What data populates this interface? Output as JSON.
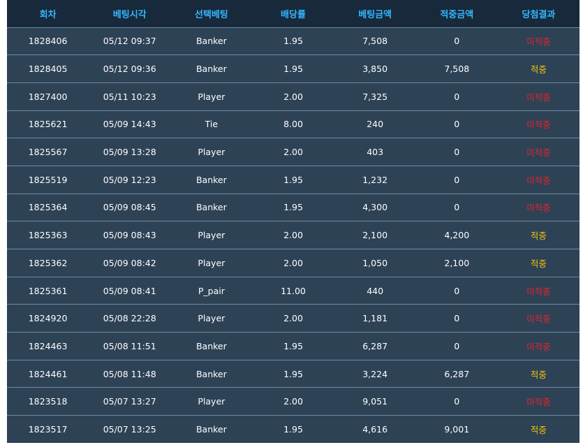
{
  "headers": [
    "회차",
    "베팅시각",
    "선택베팅",
    "배당률",
    "베팅금액",
    "적중금액",
    "당첨결과"
  ],
  "rows": [
    {
      "round": "1828406",
      "time": "05/12 09:37",
      "pick": "Banker",
      "odds": "1.95",
      "bet": "7,508",
      "payout": "0",
      "result": "미적중",
      "status": "lose"
    },
    {
      "round": "1828405",
      "time": "05/12 09:36",
      "pick": "Banker",
      "odds": "1.95",
      "bet": "3,850",
      "payout": "7,508",
      "result": "적중",
      "status": "win"
    },
    {
      "round": "1827400",
      "time": "05/11 10:23",
      "pick": "Player",
      "odds": "2.00",
      "bet": "7,325",
      "payout": "0",
      "result": "미적중",
      "status": "lose"
    },
    {
      "round": "1825621",
      "time": "05/09 14:43",
      "pick": "Tie",
      "odds": "8.00",
      "bet": "240",
      "payout": "0",
      "result": "미적중",
      "status": "lose"
    },
    {
      "round": "1825567",
      "time": "05/09 13:28",
      "pick": "Player",
      "odds": "2.00",
      "bet": "403",
      "payout": "0",
      "result": "미적중",
      "status": "lose"
    },
    {
      "round": "1825519",
      "time": "05/09 12:23",
      "pick": "Banker",
      "odds": "1.95",
      "bet": "1,232",
      "payout": "0",
      "result": "미적중",
      "status": "lose"
    },
    {
      "round": "1825364",
      "time": "05/09 08:45",
      "pick": "Banker",
      "odds": "1.95",
      "bet": "4,300",
      "payout": "0",
      "result": "미적중",
      "status": "lose"
    },
    {
      "round": "1825363",
      "time": "05/09 08:43",
      "pick": "Player",
      "odds": "2.00",
      "bet": "2,100",
      "payout": "4,200",
      "result": "적중",
      "status": "win"
    },
    {
      "round": "1825362",
      "time": "05/09 08:42",
      "pick": "Player",
      "odds": "2.00",
      "bet": "1,050",
      "payout": "2,100",
      "result": "적중",
      "status": "win"
    },
    {
      "round": "1825361",
      "time": "05/09 08:41",
      "pick": "P_pair",
      "odds": "11.00",
      "bet": "440",
      "payout": "0",
      "result": "미적중",
      "status": "lose"
    },
    {
      "round": "1824920",
      "time": "05/08 22:28",
      "pick": "Player",
      "odds": "2.00",
      "bet": "1,181",
      "payout": "0",
      "result": "미적중",
      "status": "lose"
    },
    {
      "round": "1824463",
      "time": "05/08 11:51",
      "pick": "Banker",
      "odds": "1.95",
      "bet": "6,287",
      "payout": "0",
      "result": "미적중",
      "status": "lose"
    },
    {
      "round": "1824461",
      "time": "05/08 11:48",
      "pick": "Banker",
      "odds": "1.95",
      "bet": "3,224",
      "payout": "6,287",
      "result": "적중",
      "status": "win"
    },
    {
      "round": "1823518",
      "time": "05/07 13:27",
      "pick": "Player",
      "odds": "2.00",
      "bet": "9,051",
      "payout": "0",
      "result": "미적중",
      "status": "lose"
    },
    {
      "round": "1823517",
      "time": "05/07 13:25",
      "pick": "Banker",
      "odds": "1.95",
      "bet": "4,616",
      "payout": "9,001",
      "result": "적중",
      "status": "win"
    }
  ],
  "colors": {
    "header_bg": "#17293a",
    "header_text": "#35b6ff",
    "row_bg": "#2e4256",
    "row_divider": "#6f8a9f",
    "cell_text": "#ffffff",
    "lose_text": "#e3232c",
    "win_text": "#f2c20a"
  }
}
